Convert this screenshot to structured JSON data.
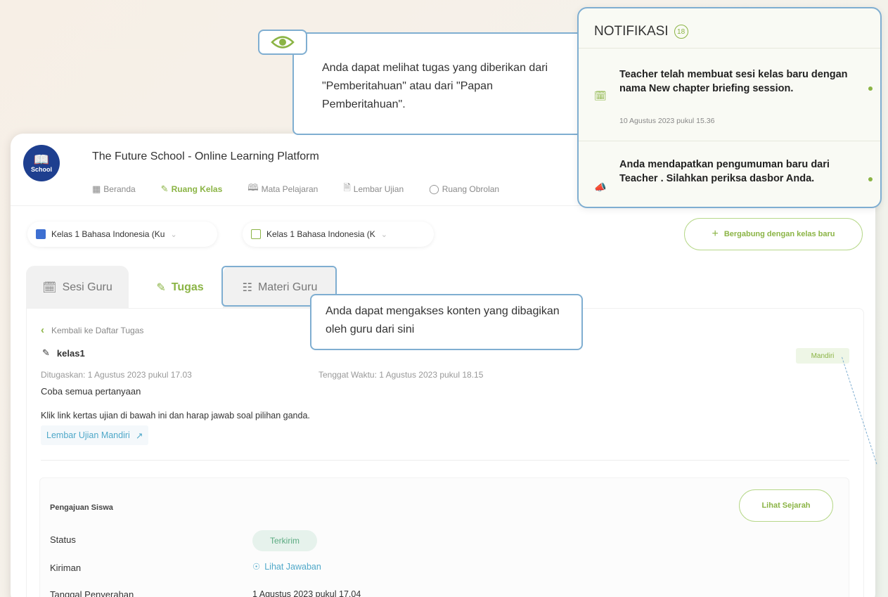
{
  "app": {
    "logo_text": "School",
    "title": "The Future School - Online Learning Platform",
    "nav": [
      {
        "label": "Beranda",
        "icon": "grid-icon"
      },
      {
        "label": "Ruang Kelas",
        "icon": "pen-icon"
      },
      {
        "label": "Mata Pelajaran",
        "icon": "book-icon"
      },
      {
        "label": "Lembar Ujian",
        "icon": "exam-sheet-icon"
      },
      {
        "label": "Ruang Obrolan",
        "icon": "chat-icon"
      }
    ]
  },
  "filters": {
    "class_select_1": "Kelas 1 Bahasa Indonesia (Ku",
    "class_select_2": "Kelas 1 Bahasa Indonesia (K",
    "join_button": "Bergabung dengan kelas baru"
  },
  "tabs": [
    {
      "label": "Sesi Guru"
    },
    {
      "label": "Tugas"
    },
    {
      "label": "Materi Guru"
    }
  ],
  "task": {
    "back_label": "Kembali ke Daftar Tugas",
    "title": "kelas1",
    "badge": "Mandiri",
    "assigned": "Ditugaskan: 1 Agustus 2023 pukul 17.03",
    "due": "Tenggat Waktu: 1 Agustus 2023 pukul 18.15",
    "desc_short": "Coba semua pertanyaan",
    "desc_long": "Klik link kertas ujian di bawah ini dan harap jawab soal pilihan ganda.",
    "exam_link": "Lembar Ujian Mandiri"
  },
  "submission": {
    "title": "Pengajuan Siswa",
    "history_button": "Lihat Sejarah",
    "status_label": "Status",
    "status_value": "Terkirim",
    "sent_label": "Kiriman",
    "sent_value": "Lihat Jawaban",
    "date_label": "Tanggal Penyerahan",
    "date_value": "1 Agustus 2023 pukul 17.04"
  },
  "callouts": {
    "notification_hint": "Anda dapat melihat tugas yang diberikan dari \"Pemberitahuan\" atau dari \"Papan Pemberitahuan\".",
    "materials_hint": "Anda dapat mengakses konten yang dibagikan oleh guru dari sini"
  },
  "notifications": {
    "title": "NOTIFIKASI",
    "count": "18",
    "items": [
      {
        "text_pre": "Teacher telah membuat sesi kelas baru dengan nama ",
        "text_em": "New chapter briefing session.",
        "time": "10 Agustus 2023 pukul 15.36",
        "icon": "calendar-icon"
      },
      {
        "text_pre": "Anda mendapatkan pengumuman baru dari Teacher . Silahkan periksa dasbor Anda.",
        "text_em": "",
        "time": "",
        "icon": "megaphone-icon"
      }
    ]
  },
  "colors": {
    "accent": "#8bb445",
    "callout_border": "#7faed1",
    "link": "#4fa8c9",
    "logo_bg": "#1e3f8f"
  }
}
